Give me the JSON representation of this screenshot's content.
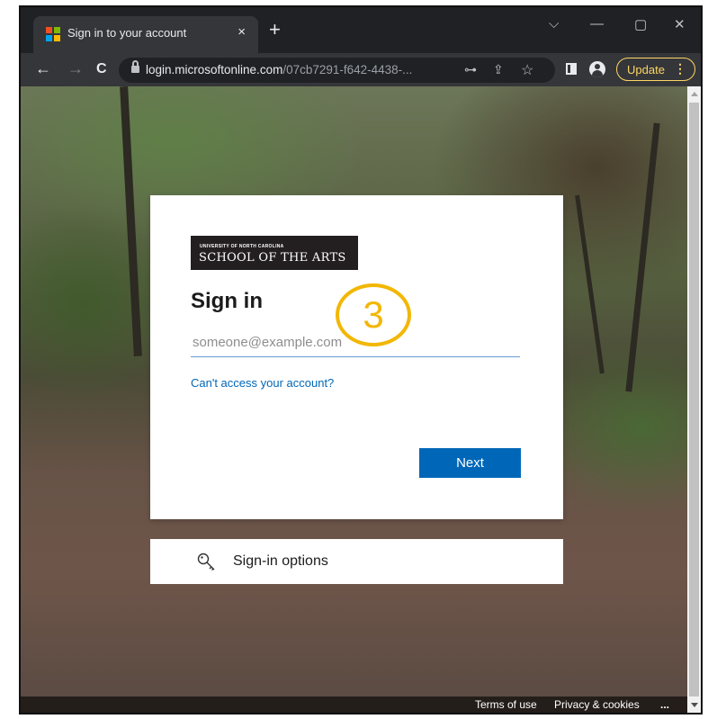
{
  "browser": {
    "tab_title": "Sign in to your account",
    "tab_close": "×",
    "new_tab": "+",
    "window": {
      "minimize": "—",
      "maximize": "▢",
      "close": "✕",
      "dropdown": "⌵"
    },
    "nav": {
      "back": "←",
      "forward": "→",
      "reload": "C"
    },
    "url_host": "login.microsoftonline.com",
    "url_rest": "/07cb7291-f642-4438-...",
    "omni_icons": {
      "key": "⊶",
      "share": "⇪",
      "star": "☆"
    },
    "update_label": "Update",
    "menu_dots": "⋮"
  },
  "card": {
    "logo_top": "UNIVERSITY OF NORTH CAROLINA",
    "logo_main": "SCHOOL OF THE ARTS",
    "heading": "Sign in",
    "email_placeholder": "someone@example.com",
    "cant_access": "Can't access your account?",
    "next_label": "Next",
    "step_badge": "3"
  },
  "signin_options": {
    "label": "Sign-in options"
  },
  "footer": {
    "terms": "Terms of use",
    "privacy": "Privacy & cookies",
    "more": "..."
  },
  "colors": {
    "accent": "#0067b8",
    "badge": "#f2b705",
    "update": "#fdd663"
  }
}
